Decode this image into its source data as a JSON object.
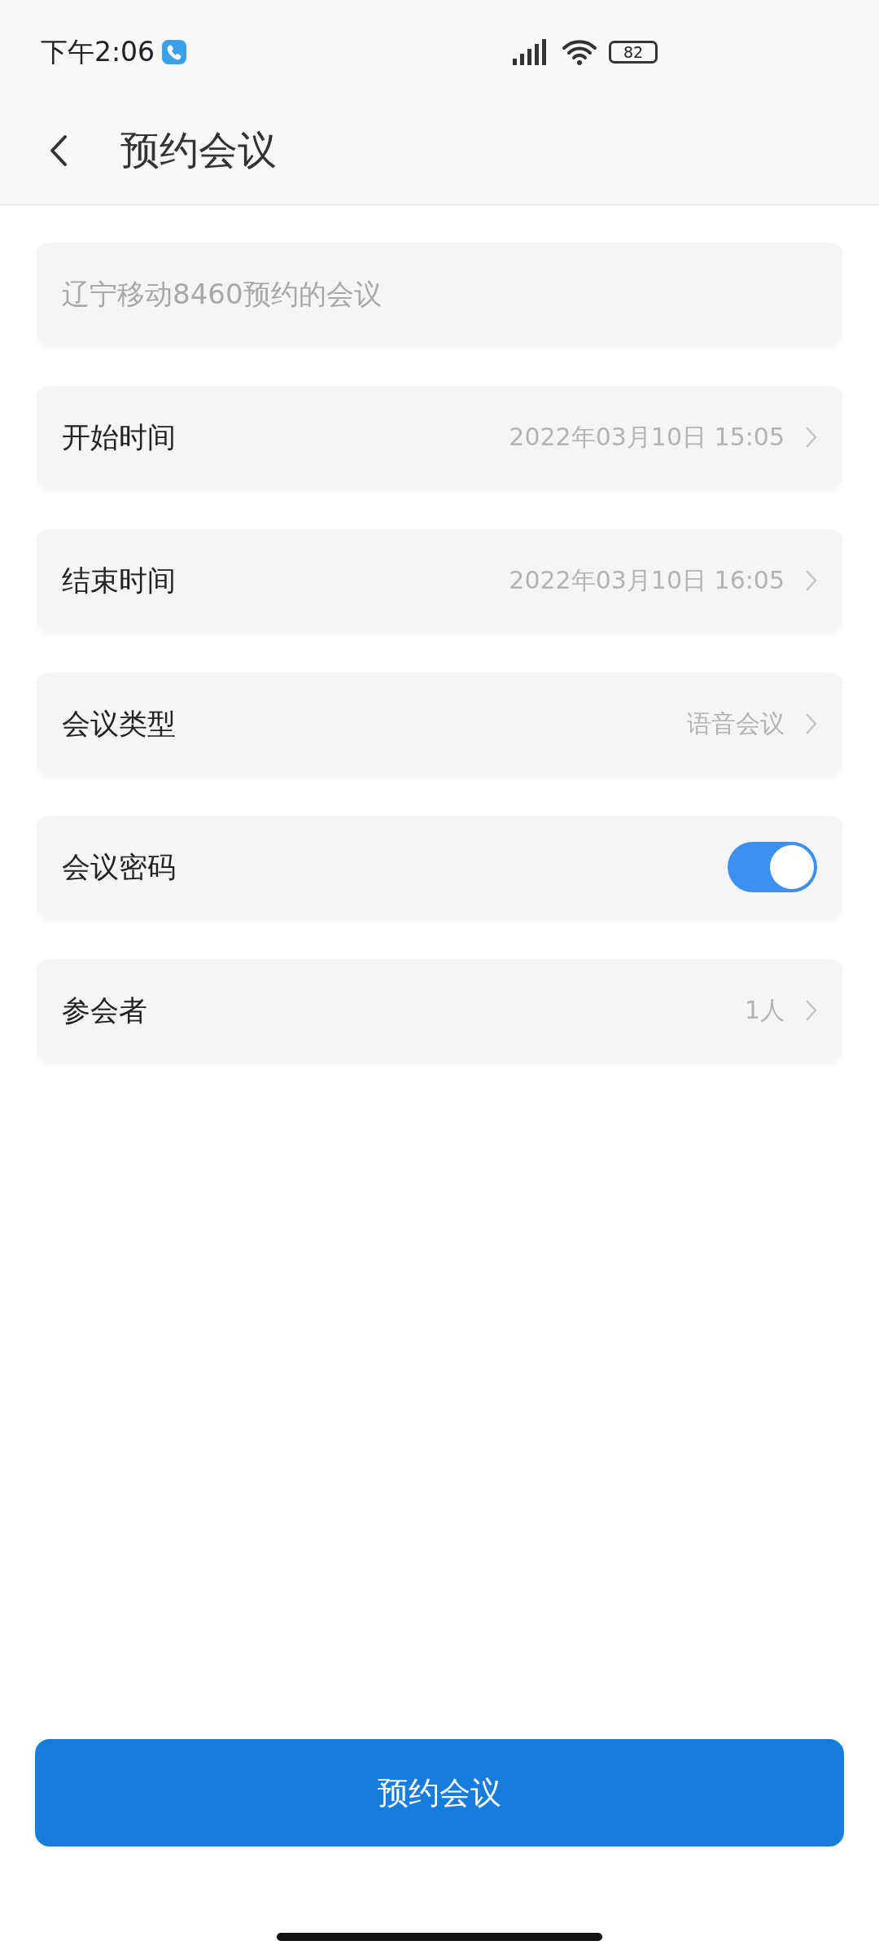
{
  "status_bar": {
    "time": "下午2:06",
    "battery": "82"
  },
  "header": {
    "title": "预约会议"
  },
  "topic_field": {
    "placeholder": "辽宁移动8460预约的会议"
  },
  "rows": [
    {
      "kind": "select",
      "label": "开始时间",
      "value": "2022年03月10日 15:05"
    },
    {
      "kind": "select",
      "label": "结束时间",
      "value": "2022年03月10日 16:05"
    },
    {
      "kind": "select",
      "label": "会议类型",
      "value": "语音会议"
    },
    {
      "kind": "toggle",
      "label": "会议密码",
      "on": true
    },
    {
      "kind": "select",
      "label": "参会者",
      "value": "1人"
    }
  ],
  "submit_button": "预约会议"
}
